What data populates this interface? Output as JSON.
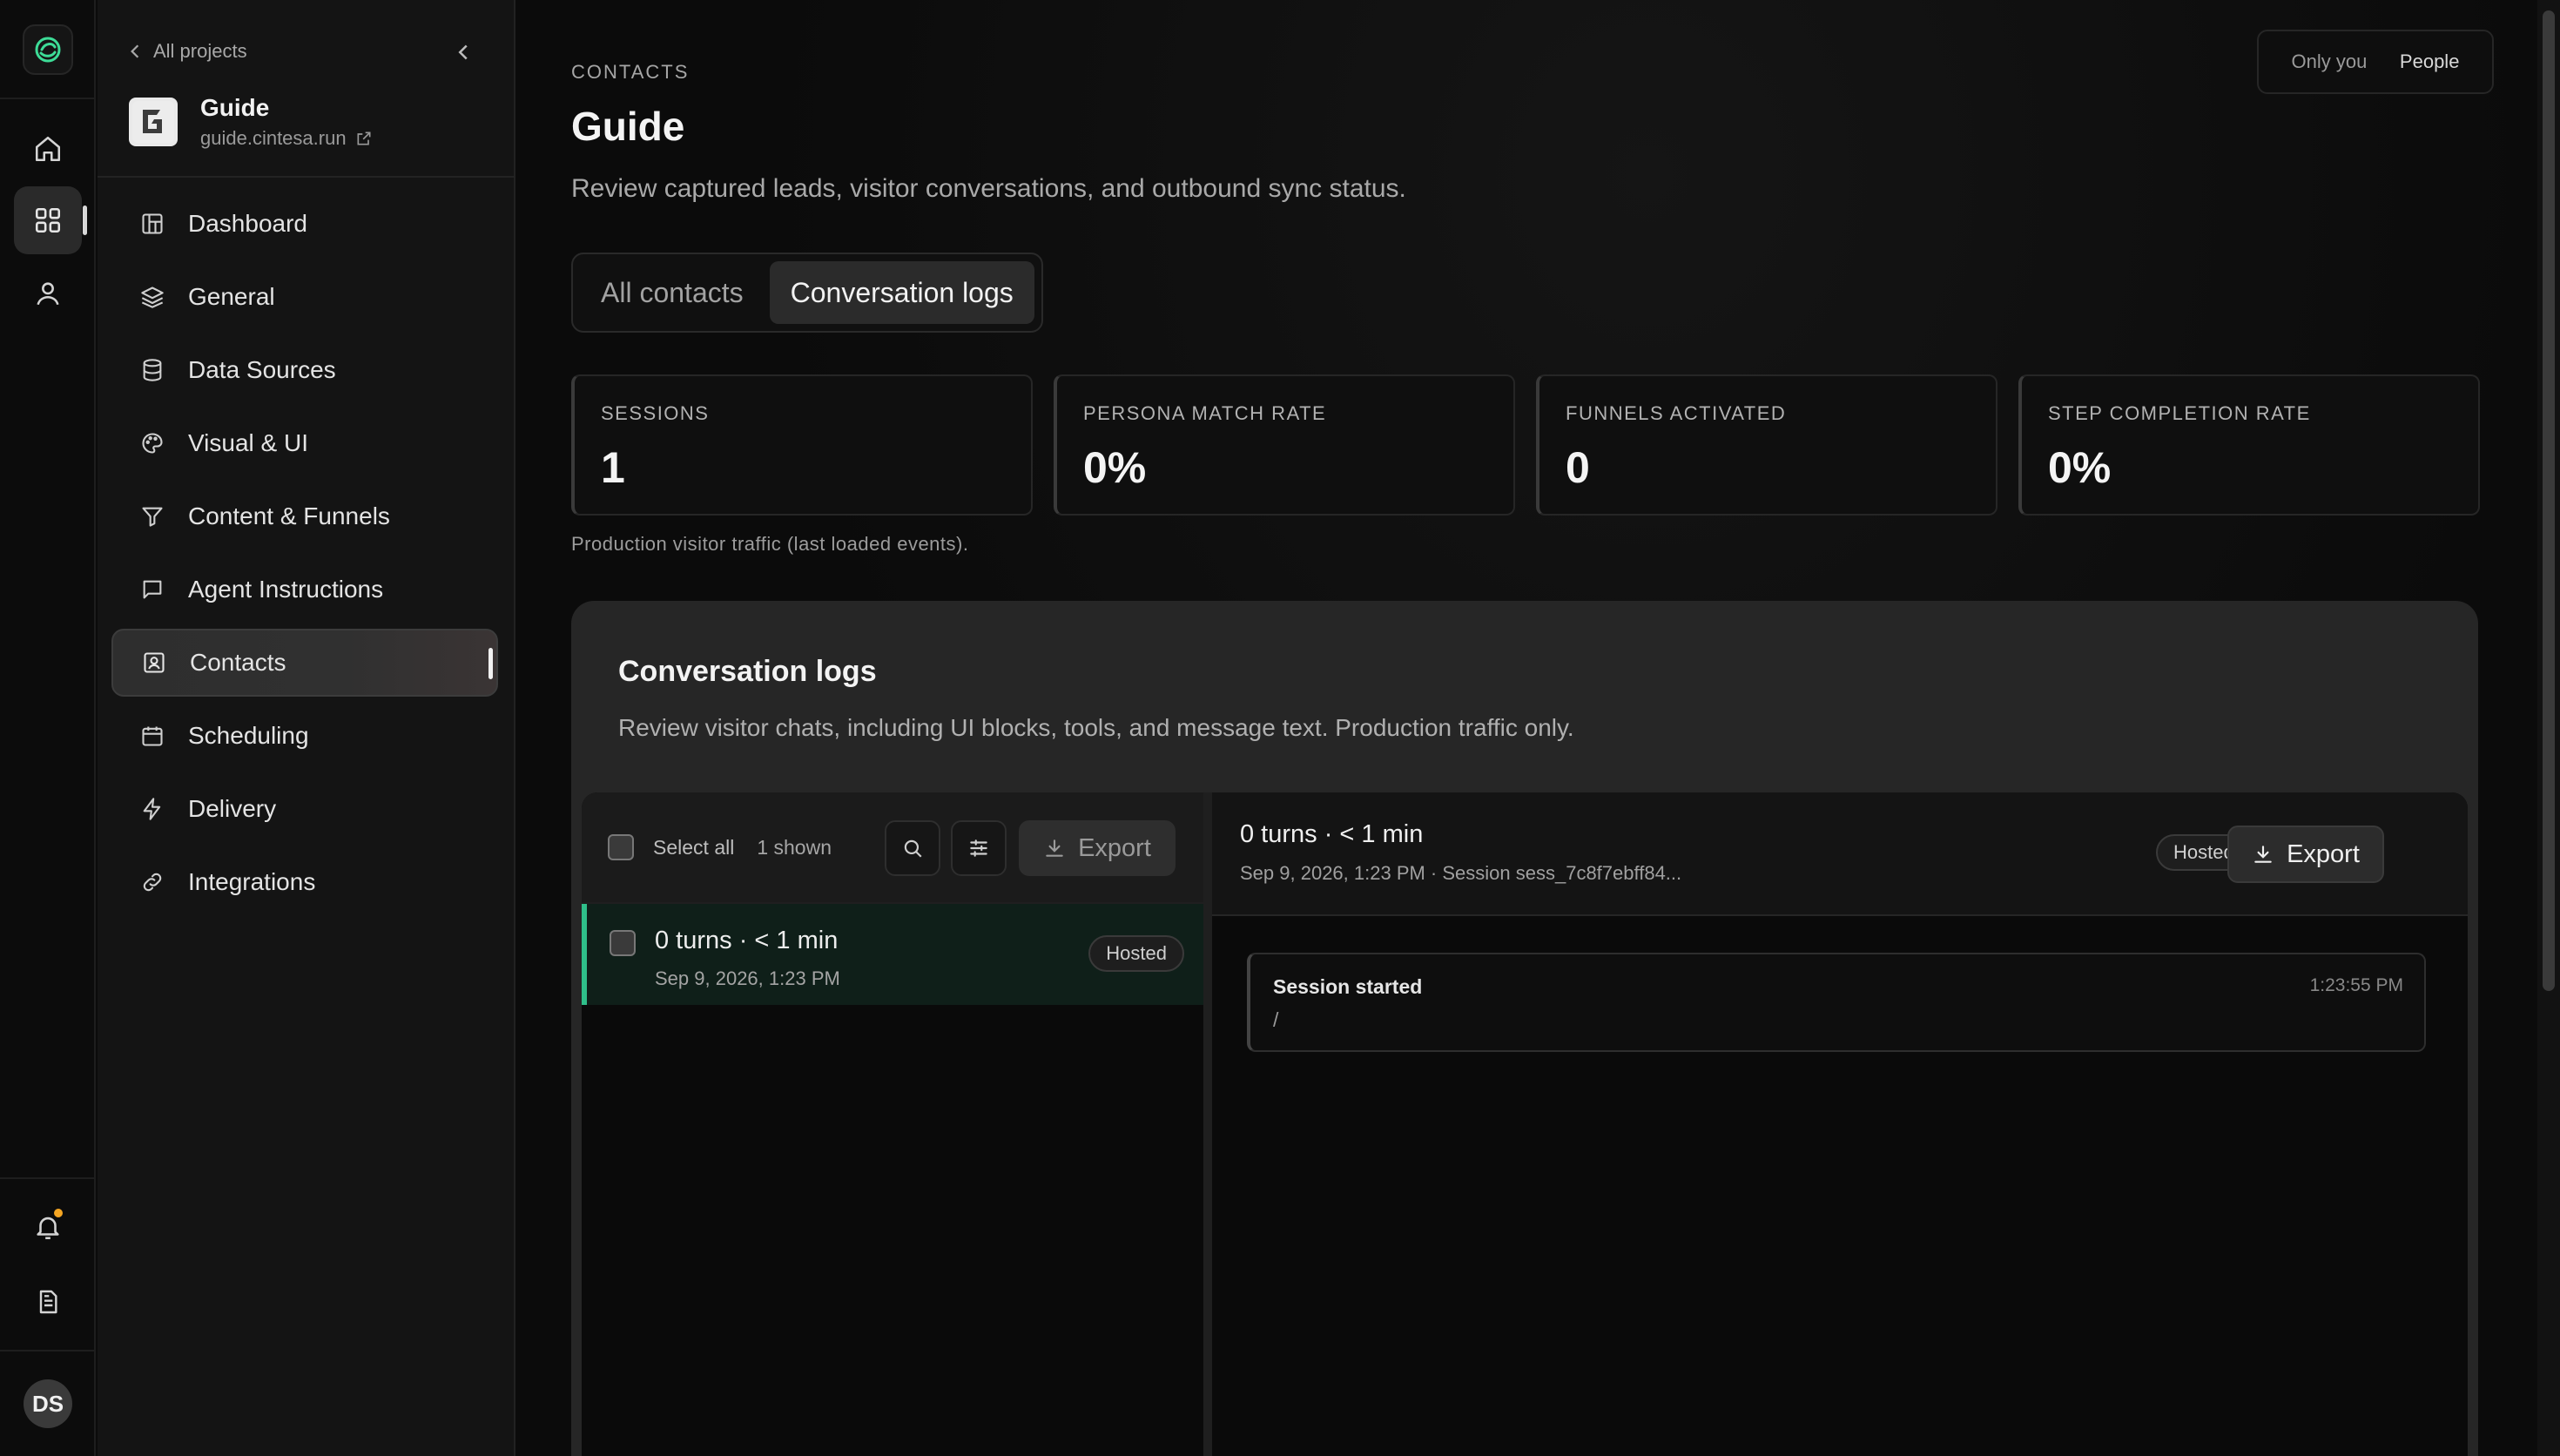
{
  "rail": {
    "items": [
      "home-icon",
      "grid-icon",
      "user-icon"
    ],
    "bottom": [
      "bell-icon",
      "document-icon"
    ],
    "avatar_initials": "DS"
  },
  "sidebar": {
    "back_label": "All projects",
    "project_name": "Guide",
    "project_url": "guide.cintesa.run",
    "items": [
      {
        "label": "Dashboard",
        "icon": "dashboard-icon"
      },
      {
        "label": "General",
        "icon": "layers-icon"
      },
      {
        "label": "Data Sources",
        "icon": "database-icon"
      },
      {
        "label": "Visual & UI",
        "icon": "palette-icon"
      },
      {
        "label": "Content & Funnels",
        "icon": "funnel-icon"
      },
      {
        "label": "Agent Instructions",
        "icon": "message-icon"
      },
      {
        "label": "Contacts",
        "icon": "contact-card-icon",
        "active": true
      },
      {
        "label": "Scheduling",
        "icon": "calendar-icon"
      },
      {
        "label": "Delivery",
        "icon": "bolt-icon"
      },
      {
        "label": "Integrations",
        "icon": "link-icon"
      }
    ]
  },
  "header": {
    "breadcrumb": "CONTACTS",
    "title": "Guide",
    "subtitle": "Review captured leads, visitor conversations, and outbound sync status.",
    "audience": {
      "option_1": "Only you",
      "option_2": "People"
    }
  },
  "tabs": [
    {
      "label": "All contacts",
      "active": false
    },
    {
      "label": "Conversation logs",
      "active": true
    }
  ],
  "stats": [
    {
      "label": "SESSIONS",
      "value": "1"
    },
    {
      "label": "PERSONA MATCH RATE",
      "value": "0%"
    },
    {
      "label": "FUNNELS ACTIVATED",
      "value": "0"
    },
    {
      "label": "STEP COMPLETION RATE",
      "value": "0%"
    }
  ],
  "stats_note": "Production visitor traffic (last loaded events).",
  "panel": {
    "title": "Conversation logs",
    "description": "Review visitor chats, including UI blocks, tools, and message text. Production traffic only.",
    "list": {
      "select_all": "Select all",
      "shown_count": "1 shown",
      "export_label": "Export",
      "rows": [
        {
          "title": "0 turns · < 1 min",
          "date": "Sep 9, 2026, 1:23 PM",
          "badge": "Hosted"
        }
      ]
    },
    "detail": {
      "title": "0 turns · < 1 min",
      "meta": "Sep 9, 2026, 1:23 PM · Session sess_7c8f7ebff84...",
      "badge": "Hosted",
      "export_label": "Export",
      "events": [
        {
          "title": "Session started",
          "path": "/",
          "time": "1:23:55 PM"
        }
      ]
    }
  },
  "colors": {
    "accent_green": "#2fbf8a",
    "notification": "#f5a623"
  }
}
